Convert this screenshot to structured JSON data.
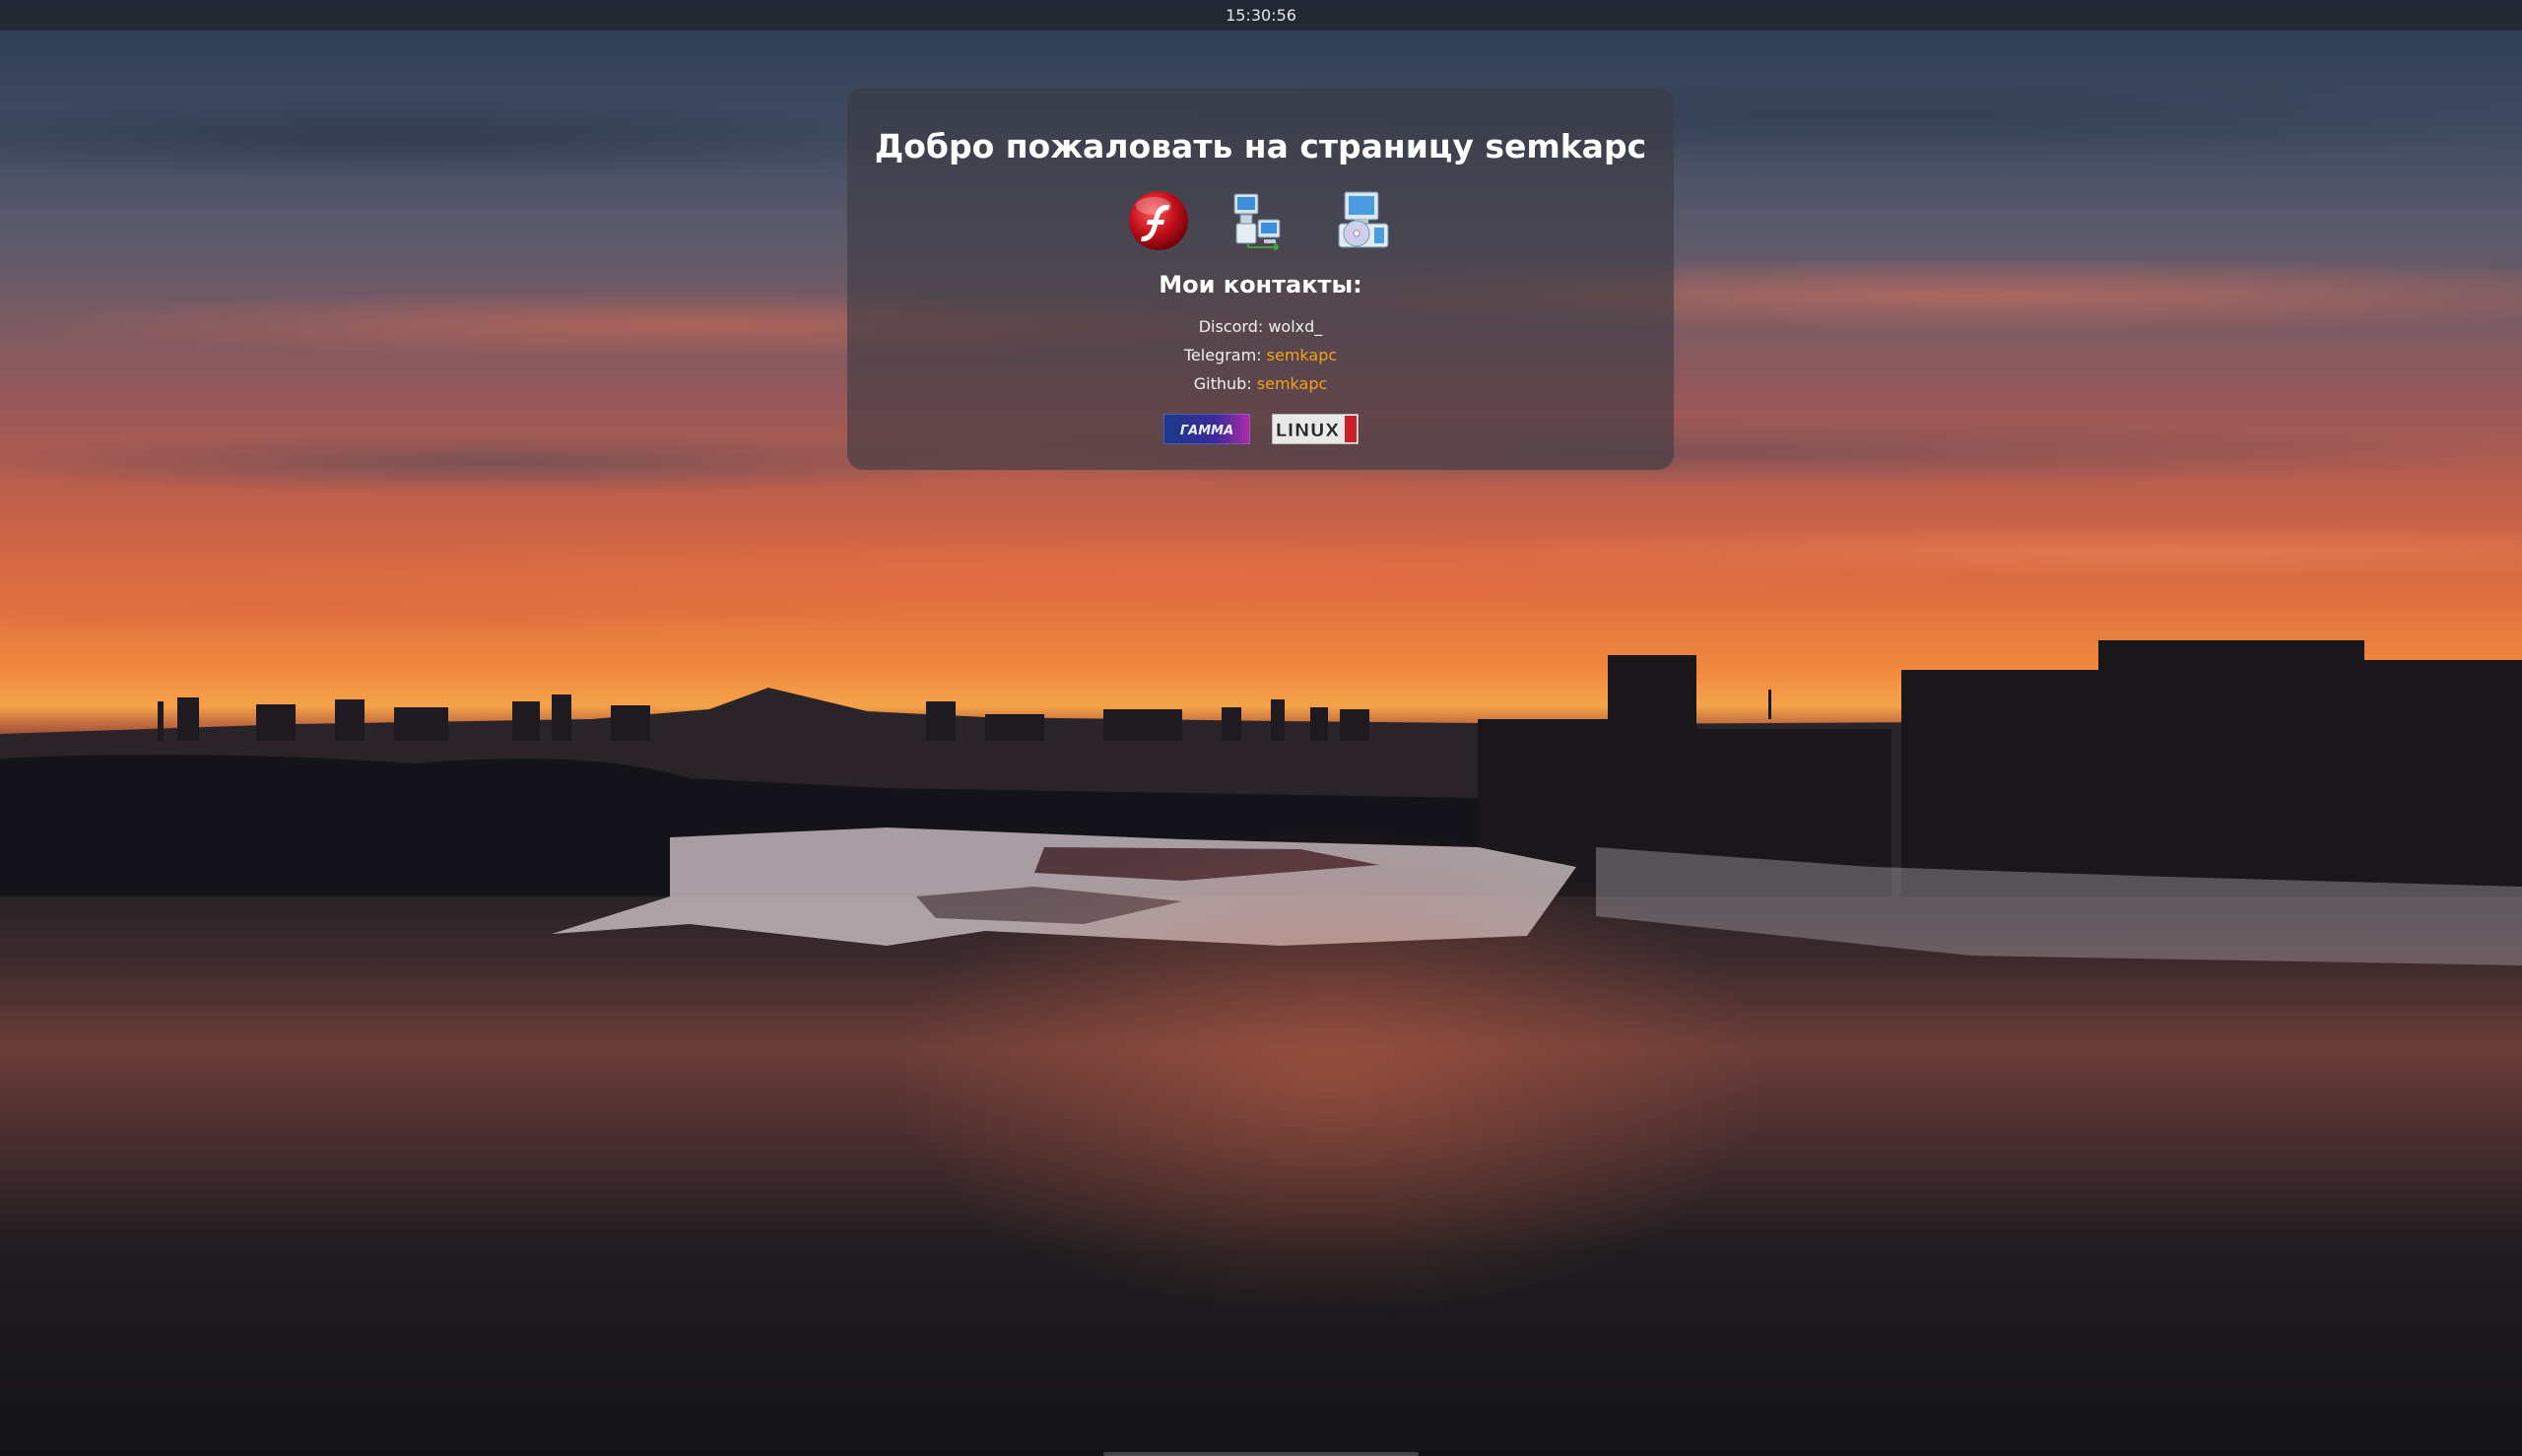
{
  "topbar": {
    "clock": "15:30:56"
  },
  "card": {
    "title": "Добро пожаловать на страницу semkapc",
    "icons": [
      {
        "name": "flash-player-icon"
      },
      {
        "name": "network-computers-icon"
      },
      {
        "name": "cd-computer-icon"
      }
    ],
    "contacts_heading": "Мои контакты:",
    "contacts": {
      "discord_label": "Discord:",
      "discord_value": "wolxd_",
      "telegram_label": "Telegram:",
      "telegram_link": "semkapc",
      "github_label": "Github:",
      "github_link": "semkapc"
    },
    "badges": {
      "gamma_text": "ГАММА",
      "linux_text": "LINUX"
    }
  },
  "colors": {
    "link": "#f3a21a",
    "card_bg": "rgba(60,58,66,0.62)"
  }
}
